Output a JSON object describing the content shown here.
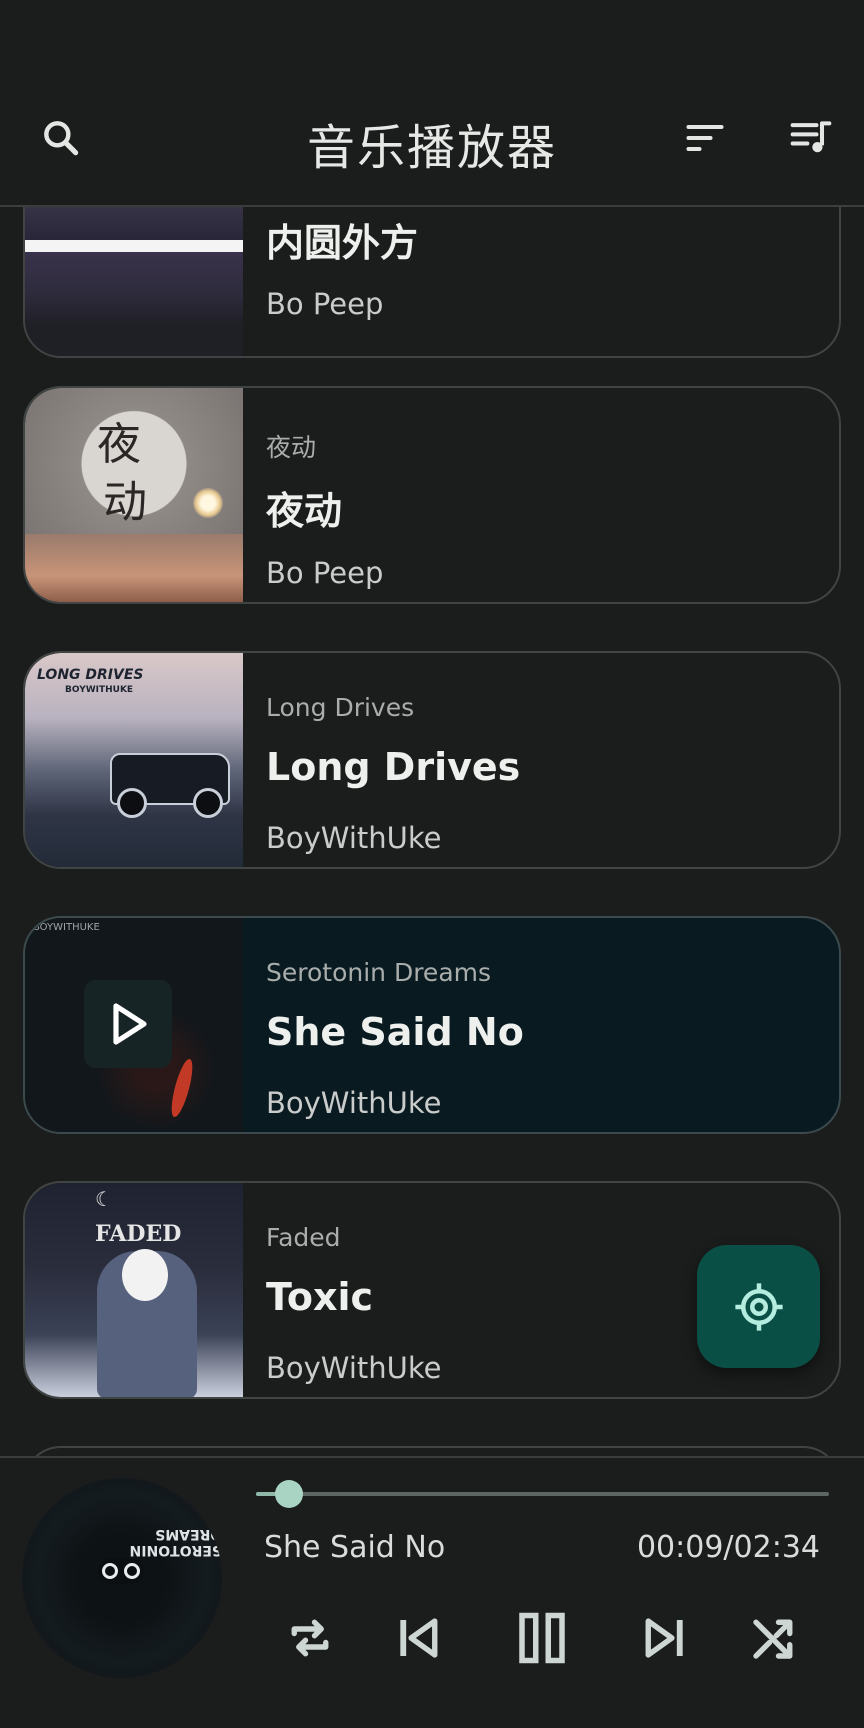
{
  "header": {
    "title": "音乐播放器",
    "icons": [
      "search-icon",
      "sort-icon",
      "queue-music-icon"
    ]
  },
  "songs": [
    {
      "album": "",
      "title": "内圆外方",
      "artist": "Bo Peep",
      "active": false
    },
    {
      "album": "夜动",
      "title": "夜动",
      "artist": "Bo Peep",
      "active": false,
      "art_text": [
        "夜",
        "动"
      ]
    },
    {
      "album": "Long Drives",
      "title": "Long Drives",
      "artist": "BoyWithUke",
      "active": false,
      "art_text": [
        "LONG DRIVES",
        "BOYWITHUKE"
      ]
    },
    {
      "album": "Serotonin Dreams",
      "title": "She Said No",
      "artist": "BoyWithUke",
      "active": true,
      "art_text": [
        "BOYWITHUKE"
      ]
    },
    {
      "album": "Faded",
      "title": "Toxic",
      "artist": "BoyWithUke",
      "active": false,
      "art_text": [
        "FADED"
      ]
    }
  ],
  "fab": {
    "icon": "locate-icon"
  },
  "player": {
    "title": "She Said No",
    "time": "00:09/02:34",
    "progress": 0.058,
    "disc_text": "SEROTONIN DREAMS",
    "controls": [
      "repeat-icon",
      "previous-icon",
      "pause-icon",
      "next-icon",
      "shuffle-icon"
    ]
  },
  "colors": {
    "background": "#1b1c1c",
    "active_card": "#091a21",
    "fab": "#0a4f45",
    "accent": "#a9d4c4"
  }
}
